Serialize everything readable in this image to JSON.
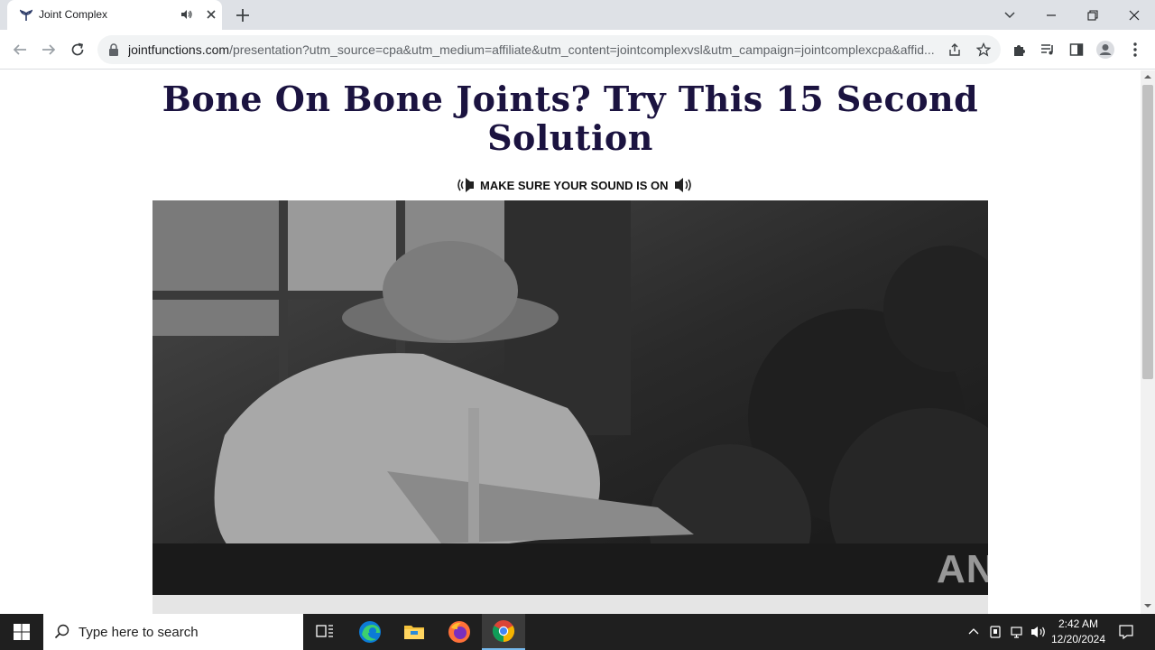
{
  "browser": {
    "tab": {
      "title": "Joint Complex"
    },
    "url": {
      "host": "jointfunctions.com",
      "path": "/presentation?utm_source=cpa&utm_medium=affiliate&utm_content=jointcomplexvsl&utm_campaign=jointcomplexcpa&affid..."
    }
  },
  "page": {
    "headline": "Bone On Bone Joints? Try This 15 Second Solution",
    "sound_notice": "MAKE SURE YOUR SOUND IS ON",
    "watermark": "ANY RUN"
  },
  "taskbar": {
    "search_placeholder": "Type here to search",
    "time": "2:42 AM",
    "date": "12/20/2024"
  },
  "colors": {
    "headline": "#1b1340",
    "tab_strip": "#dee1e6",
    "taskbar": "#1f1f1f",
    "accent": "#76b9ed"
  }
}
